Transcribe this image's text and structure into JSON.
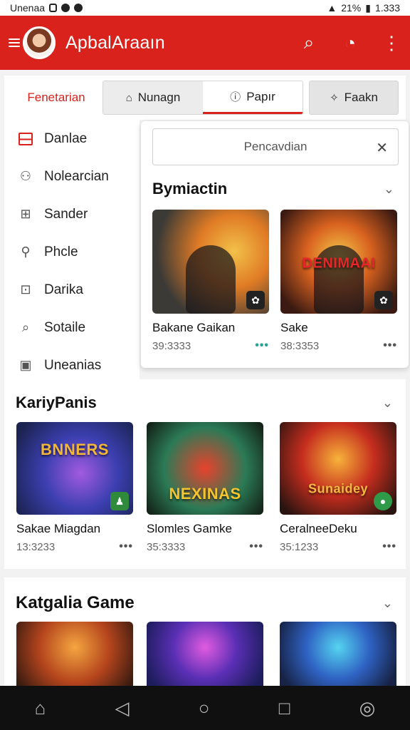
{
  "status_bar": {
    "carrier": "Unenaa",
    "battery": "21%",
    "time": "1.333"
  },
  "app_bar": {
    "title": "ApbalAraaın"
  },
  "tabs": {
    "first": "Fenetarian",
    "items": [
      "Nunagn",
      "Papır"
    ],
    "last": "Faakn"
  },
  "sidebar": {
    "items": [
      "Danlae",
      "Nolearcian",
      "Sander",
      "Phcle",
      "Darika",
      "Sotaile",
      "Uneanias"
    ]
  },
  "panel": {
    "search_placeholder": "Pencavdian",
    "section_title": "Bymiactin",
    "cards": [
      {
        "title": "Bakane Gaikan",
        "meta": "39:3333",
        "art": ""
      },
      {
        "title": "Sake",
        "meta": "38:3353",
        "art": "DENIMAAI"
      }
    ]
  },
  "section2": {
    "title": "KariyPanis",
    "cards": [
      {
        "title": "Sakae Miagdan",
        "meta": "13:3233",
        "art": "BNNERS"
      },
      {
        "title": "Slomles Gamke",
        "meta": "35:3333",
        "art": "NEXINAS"
      },
      {
        "title": "CeralneeDeku",
        "meta": "35:1233",
        "art": "Sunaidey"
      }
    ]
  },
  "section3": {
    "title": "Katgalia Game"
  },
  "colors": {
    "accent": "#d9221c",
    "navbar": "#101010"
  },
  "icons": [
    "menu-icon",
    "search-icon",
    "timer-icon",
    "more-vert-icon",
    "home-icon",
    "back-icon",
    "circle-home-icon",
    "square-icon",
    "compass-icon"
  ]
}
